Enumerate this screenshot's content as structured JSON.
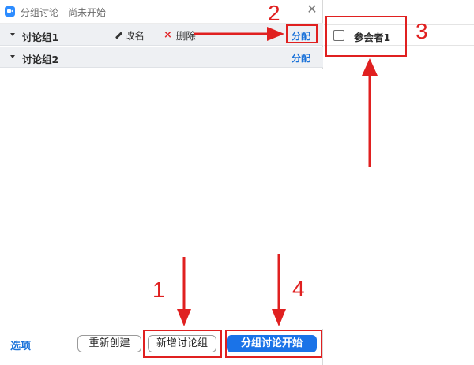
{
  "window": {
    "title": "分组讨论 - 尚未开始",
    "icon": "zoom-app-icon",
    "close_glyph": "✕"
  },
  "groups": [
    {
      "name": "讨论组1",
      "rename_label": "改名",
      "delete_label": "删除",
      "assign_label": "分配"
    },
    {
      "name": "讨论组2",
      "assign_label": "分配"
    }
  ],
  "popup": {
    "participant": "参会者1",
    "checked": false
  },
  "footer": {
    "options_label": "选项",
    "recreate_label": "重新创建",
    "add_group_label": "新增讨论组",
    "start_label": "分组讨论开始"
  },
  "annotations": {
    "step1": "1",
    "step2": "2",
    "step3": "3",
    "step4": "4",
    "color": "#e02020"
  },
  "colors": {
    "accent": "#1a72d9",
    "primary_button": "#1a73e8",
    "delete_icon": "#e0292d",
    "row_background": "#eef0f3"
  }
}
